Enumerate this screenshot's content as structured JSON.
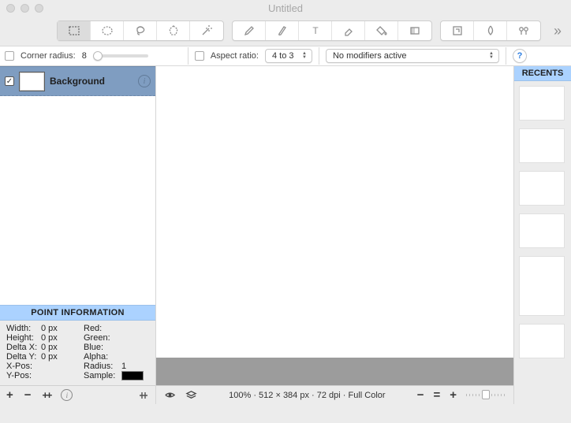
{
  "window": {
    "title": "Untitled"
  },
  "toolbar_icons": [
    "rect-select",
    "ellipse-select",
    "lasso",
    "polygon-select",
    "wand",
    "pencil",
    "brush",
    "text",
    "eraser",
    "fill",
    "gradient",
    "crop",
    "blur",
    "clone"
  ],
  "options": {
    "corner_label": "Corner radius:",
    "corner_value": "8",
    "aspect_label": "Aspect ratio:",
    "aspect_value": "4 to 3",
    "modifiers_value": "No modifiers active",
    "help": "?"
  },
  "layers": {
    "items": [
      {
        "name": "Background",
        "visible": true
      }
    ]
  },
  "point_info": {
    "heading": "POINT INFORMATION",
    "width_l": "Width:",
    "width_v": "0 px",
    "height_l": "Height:",
    "height_v": "0 px",
    "dx_l": "Delta X:",
    "dx_v": "0 px",
    "dy_l": "Delta Y:",
    "dy_v": "0 px",
    "xpos_l": "X-Pos:",
    "xpos_v": "",
    "ypos_l": "Y-Pos:",
    "ypos_v": "",
    "red_l": "Red:",
    "red_v": "",
    "green_l": "Green:",
    "green_v": "",
    "blue_l": "Blue:",
    "blue_v": "",
    "alpha_l": "Alpha:",
    "alpha_v": "",
    "radius_l": "Radius:",
    "radius_v": "1",
    "sample_l": "Sample:"
  },
  "status": {
    "text": "100% · 512 × 384 px · 72 dpi · Full Color"
  },
  "recents": {
    "heading": "RECENTS"
  }
}
